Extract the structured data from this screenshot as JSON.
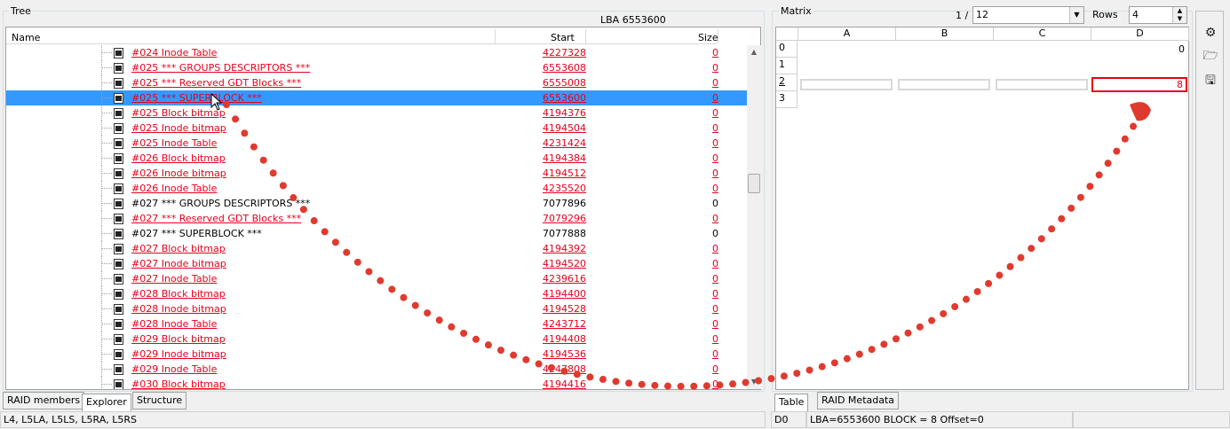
{
  "tree": {
    "title": "Tree",
    "lba_label": "LBA  6553600",
    "columns": {
      "name": "Name",
      "start": "Start",
      "size": "Size"
    },
    "rows": [
      {
        "name": "#024   Inode Table",
        "start": "4227328",
        "size": "0",
        "red": true
      },
      {
        "name": "#025   *** GROUPS DESCRIPTORS ***",
        "start": "6553608",
        "size": "0",
        "red": true
      },
      {
        "name": "#025   *** Reserved GDT Blocks ***",
        "start": "6555008",
        "size": "0",
        "red": true
      },
      {
        "name": "#025   *** SUPERBLOCK ***",
        "start": "6553600",
        "size": "0",
        "red": true,
        "selected": true
      },
      {
        "name": "#025   Block bitmap",
        "start": "4194376",
        "size": "0",
        "red": true
      },
      {
        "name": "#025   Inode bitmap",
        "start": "4194504",
        "size": "0",
        "red": true
      },
      {
        "name": "#025   Inode Table",
        "start": "4231424",
        "size": "0",
        "red": true
      },
      {
        "name": "#026   Block bitmap",
        "start": "4194384",
        "size": "0",
        "red": true
      },
      {
        "name": "#026   Inode bitmap",
        "start": "4194512",
        "size": "0",
        "red": true
      },
      {
        "name": "#026   Inode Table",
        "start": "4235520",
        "size": "0",
        "red": true
      },
      {
        "name": "#027   *** GROUPS DESCRIPTORS ***",
        "start": "7077896",
        "size": "0",
        "red": false
      },
      {
        "name": "#027   *** Reserved GDT Blocks ***",
        "start": "7079296",
        "size": "0",
        "red": true
      },
      {
        "name": "#027   *** SUPERBLOCK ***",
        "start": "7077888",
        "size": "0",
        "red": false
      },
      {
        "name": "#027   Block bitmap",
        "start": "4194392",
        "size": "0",
        "red": true
      },
      {
        "name": "#027   Inode bitmap",
        "start": "4194520",
        "size": "0",
        "red": true
      },
      {
        "name": "#027   Inode Table",
        "start": "4239616",
        "size": "0",
        "red": true
      },
      {
        "name": "#028   Block bitmap",
        "start": "4194400",
        "size": "0",
        "red": true
      },
      {
        "name": "#028   Inode bitmap",
        "start": "4194528",
        "size": "0",
        "red": true
      },
      {
        "name": "#028   Inode Table",
        "start": "4243712",
        "size": "0",
        "red": true
      },
      {
        "name": "#029   Block bitmap",
        "start": "4194408",
        "size": "0",
        "red": true
      },
      {
        "name": "#029   Inode bitmap",
        "start": "4194536",
        "size": "0",
        "red": true
      },
      {
        "name": "#029   Inode Table",
        "start": "4247808",
        "size": "0",
        "red": true
      },
      {
        "name": "#030   Block bitmap",
        "start": "4194416",
        "size": "0",
        "red": true
      }
    ]
  },
  "left_tabs": [
    "RAID members",
    "Explorer",
    "Structure"
  ],
  "left_status": "L4, L5LA, L5LS, L5RA, L5RS",
  "matrix": {
    "title": "Matrix",
    "page_label": "1 /",
    "page_value": "12",
    "rows_label": "Rows",
    "rows_value": "4",
    "col_headers": [
      "A",
      "B",
      "C",
      "D"
    ],
    "row_headers": [
      "0",
      "1",
      "2",
      "3"
    ],
    "row0_d": "0",
    "row2_d": "8"
  },
  "right_tabs": [
    "Table",
    "RAID Metadata"
  ],
  "right_status": {
    "cell": "D0",
    "info": "LBA=6553600 BLOCK = 8 Offset=0"
  },
  "colors": {
    "accent_red": "#e8001c",
    "selection": "#3399ff",
    "arrow_dots": "#e03a2f"
  },
  "icons": [
    "settings-gear-icon",
    "open-folder-icon",
    "save-disk-icon",
    "mouse-cursor-icon"
  ]
}
